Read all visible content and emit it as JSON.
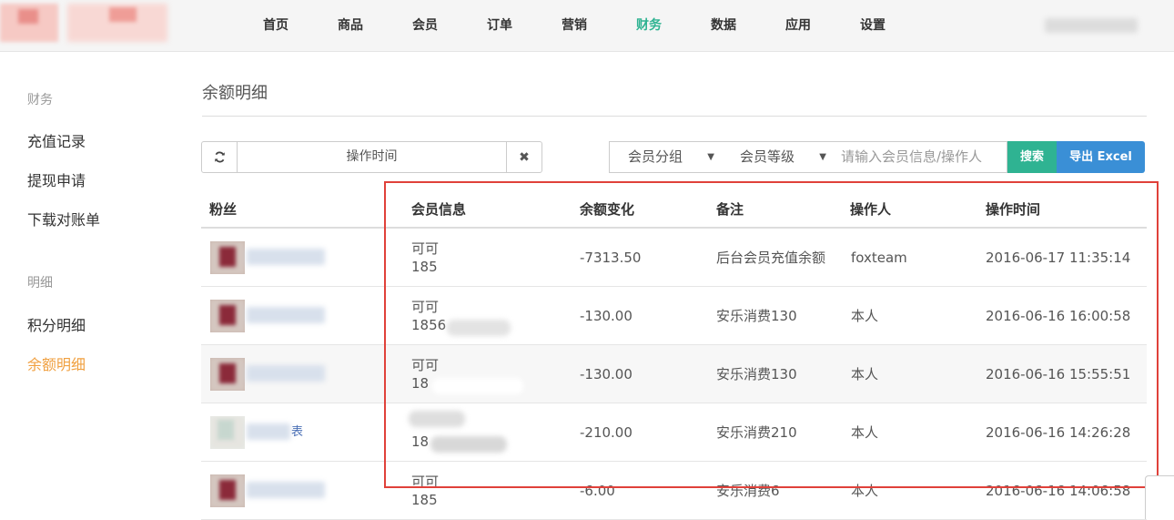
{
  "nav": {
    "items": [
      {
        "label": "首页"
      },
      {
        "label": "商品"
      },
      {
        "label": "会员"
      },
      {
        "label": "订单"
      },
      {
        "label": "营销"
      },
      {
        "label": "财务",
        "active": true
      },
      {
        "label": "数据"
      },
      {
        "label": "应用"
      },
      {
        "label": "设置"
      }
    ]
  },
  "sidebar": {
    "section1": "财务",
    "items1": [
      "充值记录",
      "提现申请",
      "下载对账单"
    ],
    "section2": "明细",
    "items2": [
      "积分明细",
      "余额明细"
    ]
  },
  "page": {
    "title": "余额明细"
  },
  "filters": {
    "date_placeholder": "操作时间",
    "member_group": "会员分组",
    "member_level": "会员等级",
    "search_placeholder": "请输入会员信息/操作人",
    "search_button": "搜索",
    "export_button": "导出 Excel"
  },
  "table": {
    "headers": [
      "粉丝",
      "会员信息",
      "余额变化",
      "备注",
      "操作人",
      "操作时间"
    ],
    "rows": [
      {
        "fan_suffix": "",
        "member_name": "可可",
        "member_phone": "185",
        "change": "-7313.50",
        "remark": "后台会员充值余额",
        "operator": "foxteam",
        "time": "2016-06-17 11:35:14"
      },
      {
        "fan_suffix": "",
        "member_name": "可可",
        "member_phone": "1856",
        "change": "-130.00",
        "remark": "安乐消费130",
        "operator": "本人",
        "time": "2016-06-16 16:00:58"
      },
      {
        "fan_suffix": "",
        "member_name": "可可",
        "member_phone": "18",
        "change": "-130.00",
        "remark": "安乐消费130",
        "operator": "本人",
        "time": "2016-06-16 15:55:51"
      },
      {
        "fan_suffix": "表",
        "member_name": "",
        "member_phone": "18",
        "change": "-210.00",
        "remark": "安乐消费210",
        "operator": "本人",
        "time": "2016-06-16 14:26:28"
      },
      {
        "fan_suffix": "",
        "member_name": "可可",
        "member_phone": "185",
        "change": "-6.00",
        "remark": "安乐消费6",
        "operator": "本人",
        "time": "2016-06-16 14:06:58"
      }
    ]
  },
  "colors": {
    "accent_green": "#2fb392",
    "accent_blue": "#3a8fd6",
    "active_side": "#f0a040",
    "highlight_red": "#e0413a"
  }
}
